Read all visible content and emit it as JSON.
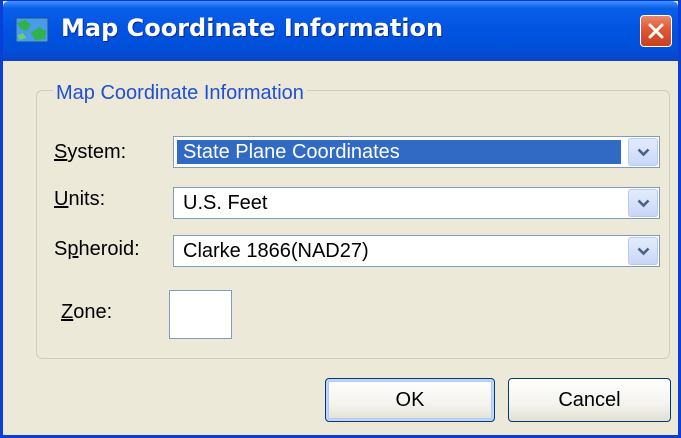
{
  "window": {
    "title": "Map Coordinate Information",
    "icon": "map-icon",
    "close_icon": "close-icon"
  },
  "group": {
    "legend": "Map Coordinate Information"
  },
  "fields": {
    "system": {
      "label_mnemonic": "S",
      "label_rest": "ystem:",
      "value": "State Plane Coordinates"
    },
    "units": {
      "label_mnemonic": "U",
      "label_rest": "nits:",
      "value": "U.S. Feet"
    },
    "spheroid": {
      "label_before": "S",
      "label_mnemonic": "p",
      "label_rest": "heroid:",
      "value": "Clarke 1866(NAD27)"
    },
    "zone": {
      "label_mnemonic": "Z",
      "label_rest": "one:",
      "value": ""
    }
  },
  "buttons": {
    "ok": "OK",
    "cancel": "Cancel"
  },
  "colors": {
    "title_bar": "#0053e1",
    "selection": "#316ac5",
    "legend_text": "#1f4fd4",
    "close_button": "#e05a36"
  }
}
